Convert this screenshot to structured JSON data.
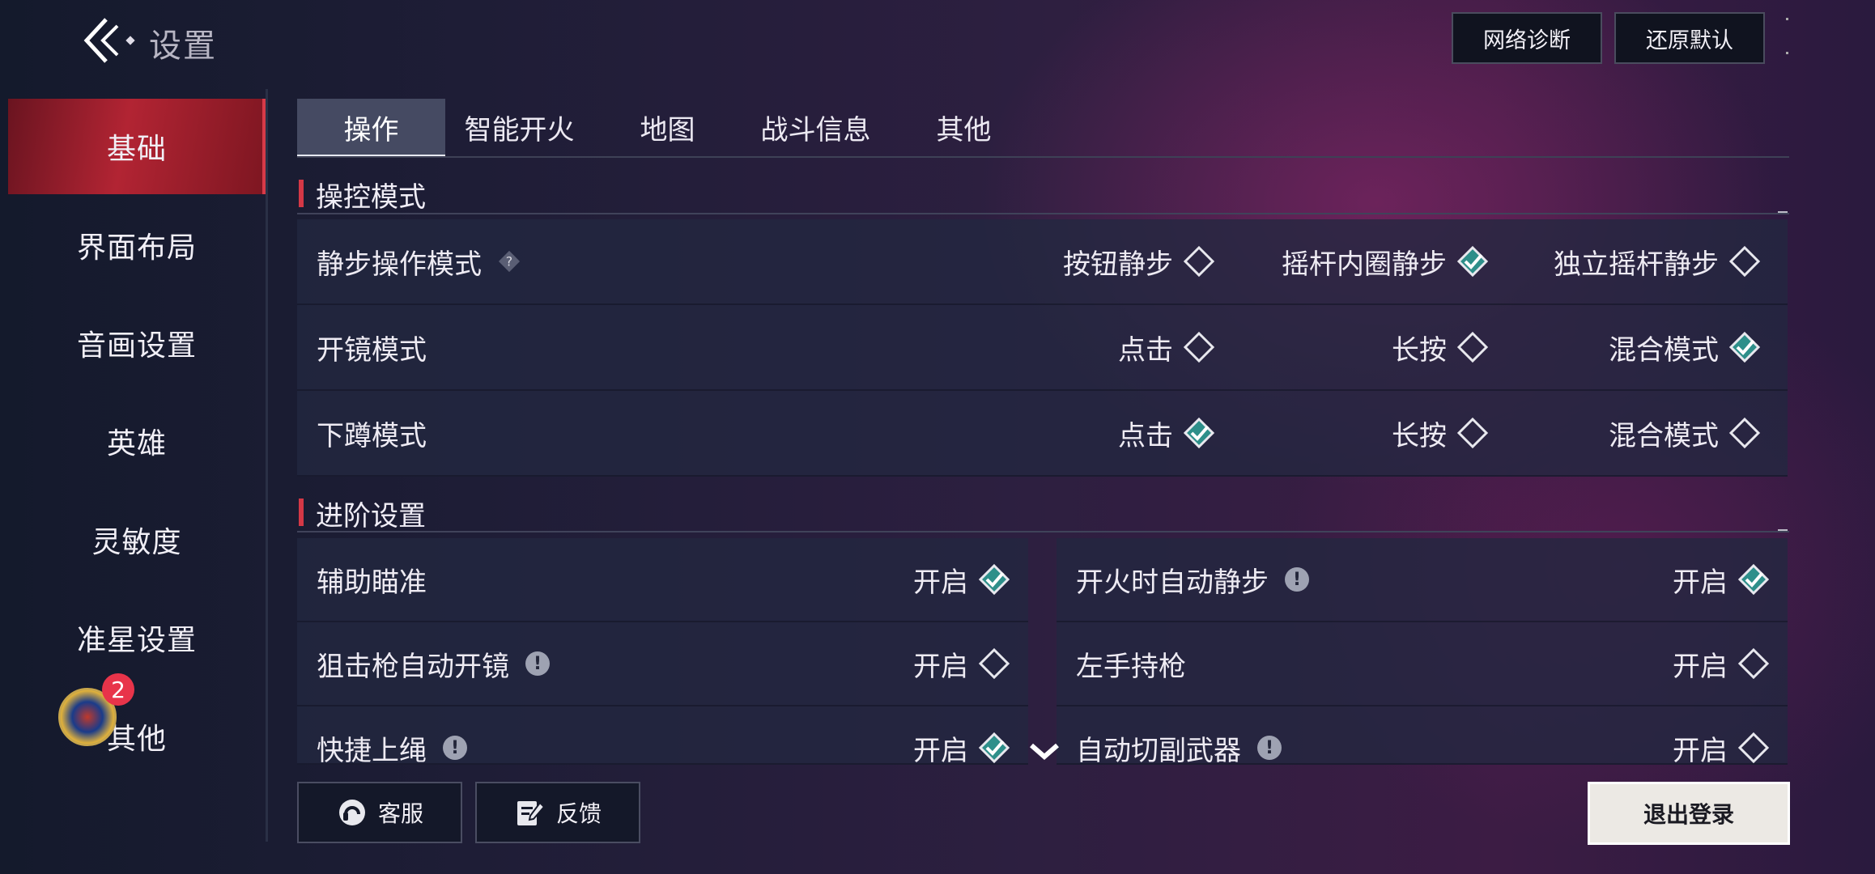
{
  "header": {
    "title": "设置",
    "network_button": "网络诊断",
    "reset_button": "还原默认"
  },
  "sidebar": {
    "items": [
      {
        "label": "基础",
        "active": true
      },
      {
        "label": "界面布局"
      },
      {
        "label": "音画设置"
      },
      {
        "label": "英雄"
      },
      {
        "label": "灵敏度"
      },
      {
        "label": "准星设置"
      },
      {
        "label": "其他"
      }
    ],
    "avatar_badge": "2"
  },
  "tabs": [
    {
      "label": "操作",
      "active": true
    },
    {
      "label": "智能开火"
    },
    {
      "label": "地图"
    },
    {
      "label": "战斗信息"
    },
    {
      "label": "其他"
    }
  ],
  "sections": {
    "control_mode": {
      "title": "操控模式",
      "rows": [
        {
          "label": "静步操作模式",
          "help_icon": "question-icon",
          "options": [
            {
              "label": "按钮静步",
              "checked": false
            },
            {
              "label": "摇杆内圈静步",
              "checked": true
            },
            {
              "label": "独立摇杆静步",
              "checked": false
            }
          ]
        },
        {
          "label": "开镜模式",
          "options": [
            {
              "label": "点击",
              "checked": false
            },
            {
              "label": "长按",
              "checked": false
            },
            {
              "label": "混合模式",
              "checked": true
            }
          ]
        },
        {
          "label": "下蹲模式",
          "options": [
            {
              "label": "点击",
              "checked": true
            },
            {
              "label": "长按",
              "checked": false
            },
            {
              "label": "混合模式",
              "checked": false
            }
          ]
        }
      ]
    },
    "advanced": {
      "title": "进阶设置",
      "left": [
        {
          "label": "辅助瞄准",
          "info": false,
          "option": "开启",
          "checked": true
        },
        {
          "label": "狙击枪自动开镜",
          "info": true,
          "option": "开启",
          "checked": false
        },
        {
          "label": "快捷上绳",
          "info": true,
          "option": "开启",
          "checked": true
        }
      ],
      "right": [
        {
          "label": "开火时自动静步",
          "info": true,
          "option": "开启",
          "checked": true
        },
        {
          "label": "左手持枪",
          "info": false,
          "option": "开启",
          "checked": false
        },
        {
          "label": "自动切副武器",
          "info": true,
          "option": "开启",
          "checked": false
        }
      ]
    }
  },
  "footer": {
    "service_button": "客服",
    "feedback_button": "反馈",
    "logout_button": "退出登录"
  },
  "colors": {
    "accent_red": "#d43846",
    "checked_teal": "#45c4b0",
    "row_bg": "#232840"
  },
  "info_glyph": "!",
  "help_glyph": "?"
}
